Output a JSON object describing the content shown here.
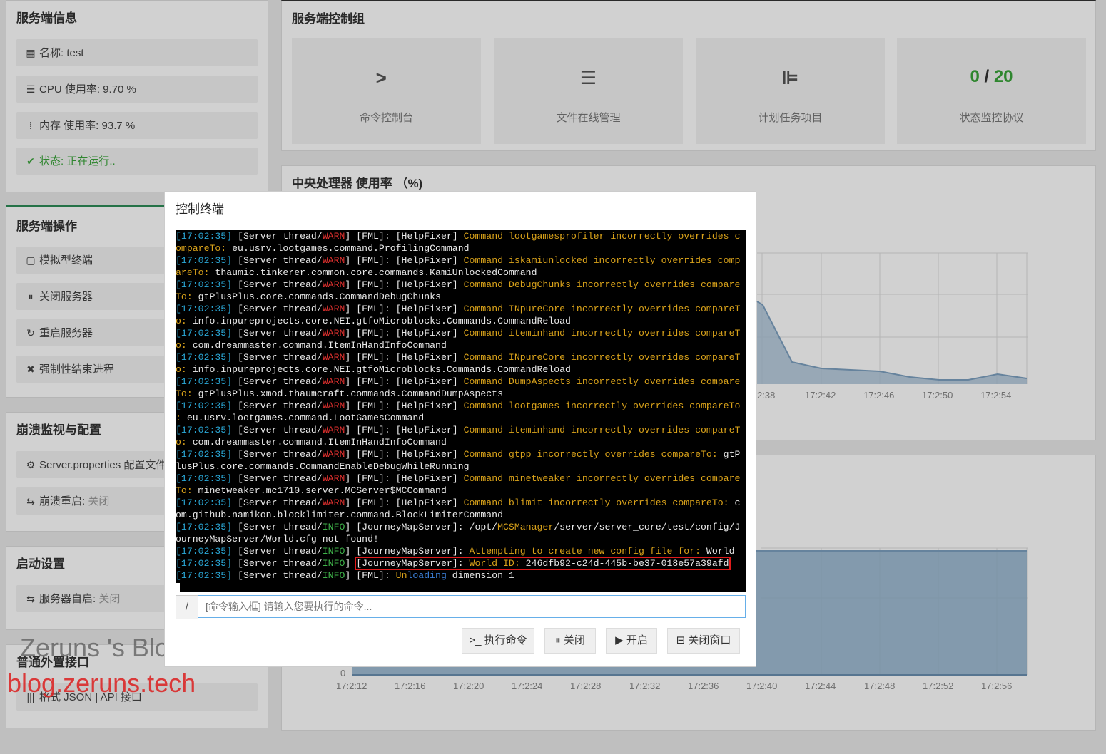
{
  "server_info": {
    "title": "服务端信息",
    "name": "名称: test",
    "cpu": "CPU 使用率: 9.70 %",
    "memory": "内存 使用率: 93.7 %",
    "status": "状态: 正在运行.."
  },
  "control_group": {
    "title": "服务端控制组",
    "items": [
      {
        "label": "命令控制台",
        "icon": ">_"
      },
      {
        "label": "文件在线管理",
        "icon": "list-icon"
      },
      {
        "label": "计划任务项目",
        "icon": "schedule-icon"
      },
      {
        "label": "状态监控协议",
        "online": "0",
        "sep": "/",
        "max": "20"
      }
    ]
  },
  "cpu_chart": {
    "title": "中央处理器 使用率 （%)",
    "x_ticks": [
      "2:38",
      "17:2:42",
      "17:2:46",
      "17:2:50",
      "17:2:54"
    ]
  },
  "mem_chart": {
    "y_zero": "0",
    "x_ticks": [
      "17:2:12",
      "17:2:16",
      "17:2:20",
      "17:2:24",
      "17:2:28",
      "17:2:32",
      "17:2:36",
      "17:2:40",
      "17:2:44",
      "17:2:48",
      "17:2:52",
      "17:2:56"
    ]
  },
  "server_ops": {
    "title": "服务端操作",
    "items": [
      "模拟型终端",
      "关闭服务器",
      "重启服务器",
      "强制性结束进程"
    ]
  },
  "crash": {
    "title": "崩溃监视与配置",
    "props": "Server.properties 配置文件",
    "restart_label": "崩溃重启: ",
    "restart_value": "关闭"
  },
  "startup": {
    "title": "启动设置",
    "auto_label": "服务器自启: ",
    "auto_value": "关闭"
  },
  "api": {
    "title": "普通外置接口",
    "item": "格式 JSON | API 接口"
  },
  "watermark": {
    "line1": "Zeruns 's Blog",
    "line2": "blog.zeruns.tech"
  },
  "modal": {
    "title": "控制终端",
    "input_prefix": "/",
    "input_placeholder": "[命令输入框] 请输入您要执行的命令...",
    "buttons": [
      "执行命令",
      "关闭",
      "开启",
      "关闭窗口"
    ]
  },
  "terminal_lines": [
    [
      [
        "ts",
        "[17:02:35]"
      ],
      [
        "w",
        " [Server thread/"
      ],
      [
        "warn",
        "WARN"
      ],
      [
        "w",
        "] [FML]: [HelpFixer] "
      ],
      [
        "yel",
        "Command lootgamesprofiler incorrectly overrides c"
      ]
    ],
    [
      [
        "yel",
        "ompareTo: "
      ],
      [
        "w",
        "eu.usrv.lootgames.command.ProfilingCommand"
      ]
    ],
    [
      [
        "ts",
        "[17:02:35]"
      ],
      [
        "w",
        " [Server thread/"
      ],
      [
        "warn",
        "WARN"
      ],
      [
        "w",
        "] [FML]: [HelpFixer] "
      ],
      [
        "yel",
        "Command iskamiunlocked incorrectly overrides comp"
      ]
    ],
    [
      [
        "yel",
        "areTo: "
      ],
      [
        "w",
        "thaumic.tinkerer.common.core.commands.KamiUnlockedCommand"
      ]
    ],
    [
      [
        "ts",
        "[17:02:35]"
      ],
      [
        "w",
        " [Server thread/"
      ],
      [
        "warn",
        "WARN"
      ],
      [
        "w",
        "] [FML]: [HelpFixer] "
      ],
      [
        "yel",
        "Command DebugChunks incorrectly overrides compare"
      ]
    ],
    [
      [
        "yel",
        "To: "
      ],
      [
        "w",
        "gtPlusPlus.core.commands.CommandDebugChunks"
      ]
    ],
    [
      [
        "ts",
        "[17:02:35]"
      ],
      [
        "w",
        " [Server thread/"
      ],
      [
        "warn",
        "WARN"
      ],
      [
        "w",
        "] [FML]: [HelpFixer] "
      ],
      [
        "yel",
        "Command INpureCore incorrectly overrides compareT"
      ]
    ],
    [
      [
        "yel",
        "o: "
      ],
      [
        "w",
        "info.inpureprojects.core.NEI.gtfoMicroblocks.Commands.CommandReload"
      ]
    ],
    [
      [
        "ts",
        "[17:02:35]"
      ],
      [
        "w",
        " [Server thread/"
      ],
      [
        "warn",
        "WARN"
      ],
      [
        "w",
        "] [FML]: [HelpFixer] "
      ],
      [
        "yel",
        "Command iteminhand incorrectly overrides compareT"
      ]
    ],
    [
      [
        "yel",
        "o: "
      ],
      [
        "w",
        "com.dreammaster.command.ItemInHandInfoCommand"
      ]
    ],
    [
      [
        "ts",
        "[17:02:35]"
      ],
      [
        "w",
        " [Server thread/"
      ],
      [
        "warn",
        "WARN"
      ],
      [
        "w",
        "] [FML]: [HelpFixer] "
      ],
      [
        "yel",
        "Command INpureCore incorrectly overrides compareT"
      ]
    ],
    [
      [
        "yel",
        "o: "
      ],
      [
        "w",
        "info.inpureprojects.core.NEI.gtfoMicroblocks.Commands.CommandReload"
      ]
    ],
    [
      [
        "ts",
        "[17:02:35]"
      ],
      [
        "w",
        " [Server thread/"
      ],
      [
        "warn",
        "WARN"
      ],
      [
        "w",
        "] [FML]: [HelpFixer] "
      ],
      [
        "yel",
        "Command DumpAspects incorrectly overrides compare"
      ]
    ],
    [
      [
        "yel",
        "To: "
      ],
      [
        "w",
        "gtPlusPlus.xmod.thaumcraft.commands.CommandDumpAspects"
      ]
    ],
    [
      [
        "ts",
        "[17:02:35]"
      ],
      [
        "w",
        " [Server thread/"
      ],
      [
        "warn",
        "WARN"
      ],
      [
        "w",
        "] [FML]: [HelpFixer] "
      ],
      [
        "yel",
        "Command lootgames incorrectly overrides compareTo"
      ]
    ],
    [
      [
        "yel",
        ": "
      ],
      [
        "w",
        "eu.usrv.lootgames.command.LootGamesCommand"
      ]
    ],
    [
      [
        "ts",
        "[17:02:35]"
      ],
      [
        "w",
        " [Server thread/"
      ],
      [
        "warn",
        "WARN"
      ],
      [
        "w",
        "] [FML]: [HelpFixer] "
      ],
      [
        "yel",
        "Command iteminhand incorrectly overrides compareT"
      ]
    ],
    [
      [
        "yel",
        "o: "
      ],
      [
        "w",
        "com.dreammaster.command.ItemInHandInfoCommand"
      ]
    ],
    [
      [
        "ts",
        "[17:02:35]"
      ],
      [
        "w",
        " [Server thread/"
      ],
      [
        "warn",
        "WARN"
      ],
      [
        "w",
        "] [FML]: [HelpFixer] "
      ],
      [
        "yel",
        "Command gtpp incorrectly overrides compareTo: "
      ],
      [
        "w",
        "gtP"
      ]
    ],
    [
      [
        "w",
        "lusPlus.core.commands.CommandEnableDebugWhileRunning"
      ]
    ],
    [
      [
        "ts",
        "[17:02:35]"
      ],
      [
        "w",
        " [Server thread/"
      ],
      [
        "warn",
        "WARN"
      ],
      [
        "w",
        "] [FML]: [HelpFixer] "
      ],
      [
        "yel",
        "Command minetweaker incorrectly overrides compare"
      ]
    ],
    [
      [
        "yel",
        "To: "
      ],
      [
        "w",
        "minetweaker.mc1710.server.MCServer$MCCommand"
      ]
    ],
    [
      [
        "ts",
        "[17:02:35]"
      ],
      [
        "w",
        " [Server thread/"
      ],
      [
        "warn",
        "WARN"
      ],
      [
        "w",
        "] [FML]: [HelpFixer] "
      ],
      [
        "yel",
        "Command blimit incorrectly overrides compareTo: "
      ],
      [
        "w",
        "c"
      ]
    ],
    [
      [
        "w",
        "om.github.namikon.blocklimiter.command.BlockLimiterCommand"
      ]
    ],
    [
      [
        "ts",
        "[17:02:35]"
      ],
      [
        "w",
        " [Server thread/"
      ],
      [
        "info",
        "INFO"
      ],
      [
        "w",
        "] [JourneyMapServer]: /opt/"
      ],
      [
        "yel",
        "MCSManager"
      ],
      [
        "w",
        "/server/server_core/test/config/J"
      ]
    ],
    [
      [
        "w",
        "ourneyMapServer/World.cfg not found!"
      ]
    ],
    [
      [
        "ts",
        "[17:02:35]"
      ],
      [
        "w",
        " [Server thread/"
      ],
      [
        "info",
        "INFO"
      ],
      [
        "w",
        "] [JourneyMapServer]: "
      ],
      [
        "yel",
        "Attempting to create new config file for: "
      ],
      [
        "w",
        "World"
      ]
    ],
    [
      [
        "ts",
        "[17:02:35]"
      ],
      [
        "w",
        " [Server thread/"
      ],
      [
        "info",
        "INFO"
      ],
      [
        "w",
        "] "
      ],
      [
        "hl",
        "[JourneyMapServer]: |World ID: |246dfb92-c24d-445b-be37-018e57a39afd"
      ]
    ],
    [
      [
        "ts",
        "[17:02:35]"
      ],
      [
        "w",
        " [Server thread/"
      ],
      [
        "info",
        "INFO"
      ],
      [
        "w",
        "] [FML]: "
      ],
      [
        "yel",
        "Un"
      ],
      [
        "blu",
        "loading"
      ],
      [
        "w",
        " dimension 1"
      ]
    ]
  ]
}
